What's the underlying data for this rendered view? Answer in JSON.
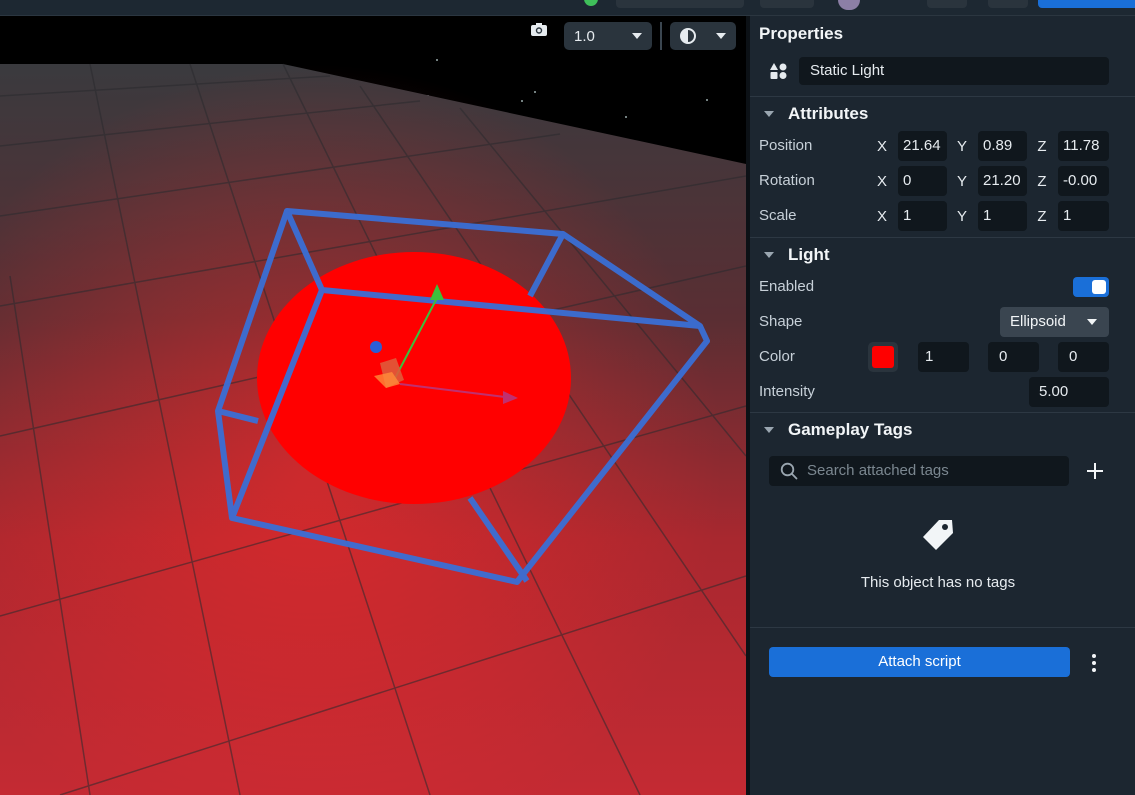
{
  "viewport": {
    "toolbar": {
      "camera_icon": "camera-icon",
      "speed_value": "1.0",
      "render_mode_icon": "circle-half-icon"
    }
  },
  "properties": {
    "title": "Properties",
    "object_name": "Static Light",
    "object_icon": "shapes-icon",
    "attributes": {
      "title": "Attributes",
      "position": {
        "label": "Position",
        "x": "21.64",
        "y": "0.89",
        "z": "11.78"
      },
      "rotation": {
        "label": "Rotation",
        "x": "0",
        "y": "21.20",
        "z": "-0.00"
      },
      "scale": {
        "label": "Scale",
        "x": "1",
        "y": "1",
        "z": "1"
      },
      "axis_x": "X",
      "axis_y": "Y",
      "axis_z": "Z"
    },
    "light": {
      "title": "Light",
      "enabled_label": "Enabled",
      "enabled": true,
      "shape_label": "Shape",
      "shape_value": "Ellipsoid",
      "color_label": "Color",
      "color_hex": "#ff0000",
      "color_r": "1",
      "color_g": "0",
      "color_b": "0",
      "intensity_label": "Intensity",
      "intensity_value": "5.00"
    },
    "gameplay_tags": {
      "title": "Gameplay Tags",
      "search_placeholder": "Search attached tags",
      "empty_text": "This object has no tags"
    },
    "attach_script_label": "Attach script"
  },
  "colors": {
    "accent": "#1a6fd8",
    "panel_bg": "#1c2630",
    "field_bg": "#10171d",
    "selection_box": "#3a6fd6",
    "light_sphere": "#ff0000"
  }
}
